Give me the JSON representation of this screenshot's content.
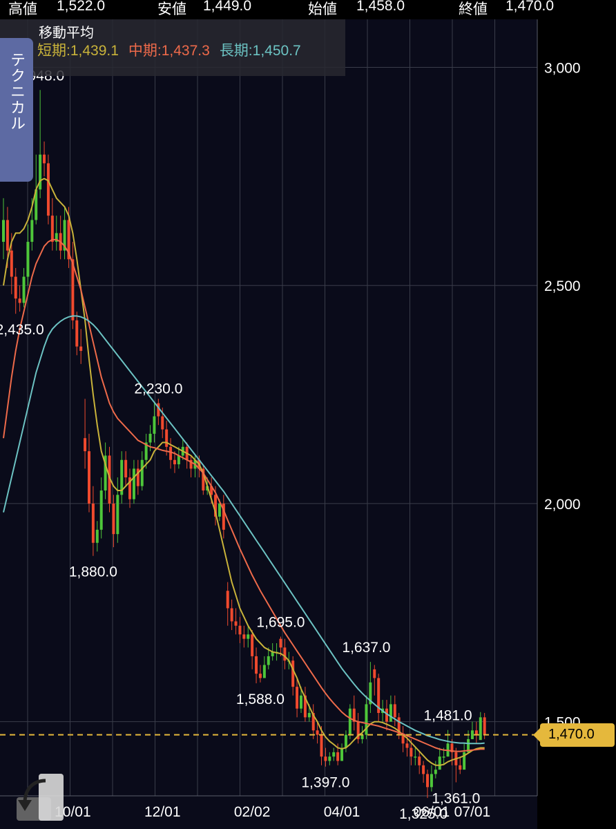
{
  "ohlc": {
    "high_label": "高値",
    "high_value": "1,522.0",
    "low_label": "安値",
    "low_value": "1,449.0",
    "open_label": "始値",
    "open_value": "1,458.0",
    "close_label": "終値",
    "close_value": "1,470.0"
  },
  "moving_average": {
    "title": "移動平均",
    "short": "短期:1,439.1",
    "mid": "中期:1,437.3",
    "long": "長期:1,450.7"
  },
  "technical_tab": "テクニカル",
  "current_price_tag": "1,470.0",
  "colors": {
    "background": "#0a0b1a",
    "grid": "#3a3d4a",
    "up": "#4ec63a",
    "down": "#f04a2e",
    "ma_short": "#c9b33a",
    "ma_mid": "#ee6a4a",
    "ma_long": "#6cc3c3",
    "price_line": "#e5b83c"
  },
  "chart_data": {
    "type": "candlestick",
    "y_ticks": [
      "3,000",
      "2,500",
      "2,000",
      "1,500"
    ],
    "y_tick_values": [
      3000,
      2500,
      2000,
      1500
    ],
    "ylim": [
      1330,
      3110
    ],
    "x_ticks": [
      "10/01",
      "12/01",
      "02/02",
      "04/01",
      "06/01",
      "07/01"
    ],
    "x_tick_index": [
      17,
      39,
      61,
      83,
      105,
      115
    ],
    "x_range": [
      0,
      125
    ],
    "annotations": [
      {
        "label": "2,948.0",
        "index": 9,
        "value": 2948
      },
      {
        "label": "2,435.0",
        "index": 4,
        "value": 2435
      },
      {
        "label": "2,230.0",
        "index": 38,
        "value": 2230
      },
      {
        "label": "1,880.0",
        "index": 22,
        "value": 1880
      },
      {
        "label": "1,695.0",
        "index": 68,
        "value": 1695
      },
      {
        "label": "1,588.0",
        "index": 63,
        "value": 1588
      },
      {
        "label": "1,637.0",
        "index": 89,
        "value": 1637
      },
      {
        "label": "1,397.0",
        "index": 79,
        "value": 1397
      },
      {
        "label": "1,481.0",
        "index": 109,
        "value": 1481
      },
      {
        "label": "1,361.0",
        "index": 111,
        "value": 1361
      },
      {
        "label": "1,325.0",
        "index": 103,
        "value": 1325
      }
    ],
    "close": [
      2650,
      2580,
      2520,
      2470,
      2460,
      2520,
      2600,
      2650,
      2720,
      2800,
      2780,
      2660,
      2600,
      2620,
      2580,
      2650,
      2560,
      2420,
      2360,
      2350,
      2120,
      2000,
      1910,
      1940,
      2030,
      2110,
      2000,
      1930,
      2020,
      2100,
      2060,
      2010,
      2080,
      2040,
      2100,
      2140,
      2160,
      2200,
      2200,
      2170,
      2130,
      2100,
      2090,
      2110,
      2130,
      2100,
      2080,
      2100,
      2080,
      2030,
      2040,
      2020,
      1970,
      2000,
      1940,
      1760,
      1730,
      1720,
      1700,
      1690,
      1700,
      1650,
      1610,
      1600,
      1630,
      1650,
      1660,
      1660,
      1670,
      1640,
      1640,
      1580,
      1530,
      1560,
      1510,
      1520,
      1480,
      1470,
      1420,
      1410,
      1420,
      1430,
      1410,
      1440,
      1470,
      1530,
      1500,
      1460,
      1470,
      1540,
      1590,
      1600,
      1520,
      1530,
      1500,
      1540,
      1510,
      1470,
      1450,
      1440,
      1420,
      1420,
      1400,
      1380,
      1350,
      1380,
      1390,
      1420,
      1420,
      1450,
      1430,
      1400,
      1390,
      1430,
      1460,
      1480,
      1470,
      1510,
      1470
    ],
    "open": [
      2600,
      2650,
      2580,
      2520,
      2470,
      2460,
      2520,
      2600,
      2650,
      2720,
      2800,
      2780,
      2660,
      2600,
      2620,
      2580,
      2650,
      2560,
      2420,
      2360,
      2150,
      2120,
      2000,
      1910,
      1940,
      2030,
      2110,
      2000,
      1930,
      2020,
      2100,
      2060,
      2010,
      2080,
      2040,
      2100,
      2140,
      2160,
      2230,
      2200,
      2170,
      2130,
      2100,
      2090,
      2110,
      2130,
      2100,
      2080,
      2100,
      2080,
      2030,
      2040,
      2020,
      1970,
      2000,
      1800,
      1760,
      1730,
      1720,
      1700,
      1690,
      1700,
      1650,
      1610,
      1600,
      1630,
      1650,
      1660,
      1690,
      1670,
      1640,
      1640,
      1580,
      1530,
      1560,
      1510,
      1520,
      1480,
      1470,
      1420,
      1410,
      1420,
      1430,
      1410,
      1440,
      1470,
      1530,
      1500,
      1460,
      1470,
      1540,
      1620,
      1600,
      1520,
      1530,
      1500,
      1540,
      1510,
      1470,
      1450,
      1440,
      1420,
      1420,
      1400,
      1380,
      1350,
      1380,
      1390,
      1420,
      1420,
      1450,
      1430,
      1400,
      1390,
      1430,
      1460,
      1480,
      1458,
      1510
    ],
    "high": [
      2700,
      2680,
      2620,
      2540,
      2500,
      2540,
      2640,
      2700,
      2800,
      2948,
      2830,
      2800,
      2700,
      2660,
      2660,
      2680,
      2680,
      2600,
      2440,
      2400,
      2240,
      2160,
      2040,
      1960,
      2060,
      2140,
      2130,
      2020,
      2060,
      2120,
      2120,
      2080,
      2100,
      2100,
      2120,
      2160,
      2180,
      2230,
      2240,
      2220,
      2190,
      2150,
      2120,
      2130,
      2150,
      2140,
      2110,
      2110,
      2110,
      2090,
      2060,
      2060,
      2040,
      2010,
      2020,
      1820,
      1780,
      1760,
      1740,
      1720,
      1720,
      1710,
      1670,
      1630,
      1650,
      1670,
      1680,
      1680,
      1695,
      1690,
      1660,
      1650,
      1600,
      1580,
      1580,
      1540,
      1540,
      1500,
      1490,
      1440,
      1430,
      1440,
      1450,
      1450,
      1480,
      1540,
      1560,
      1520,
      1490,
      1560,
      1637,
      1630,
      1610,
      1550,
      1550,
      1560,
      1560,
      1520,
      1490,
      1470,
      1460,
      1440,
      1430,
      1410,
      1390,
      1400,
      1410,
      1440,
      1440,
      1481,
      1460,
      1440,
      1420,
      1450,
      1480,
      1500,
      1500,
      1522,
      1520
    ],
    "low": [
      2560,
      2540,
      2480,
      2435,
      2440,
      2450,
      2500,
      2580,
      2640,
      2700,
      2750,
      2640,
      2580,
      2580,
      2560,
      2560,
      2540,
      2400,
      2340,
      2320,
      2080,
      1980,
      1880,
      1890,
      1920,
      2010,
      1980,
      1900,
      1910,
      2000,
      2040,
      1990,
      2000,
      2020,
      2030,
      2080,
      2120,
      2140,
      2180,
      2150,
      2110,
      2080,
      2070,
      2080,
      2100,
      2080,
      2060,
      2060,
      2060,
      2020,
      2020,
      2000,
      1950,
      1960,
      1920,
      1720,
      1710,
      1700,
      1680,
      1670,
      1670,
      1620,
      1588,
      1590,
      1600,
      1620,
      1640,
      1640,
      1650,
      1620,
      1620,
      1560,
      1510,
      1520,
      1500,
      1500,
      1460,
      1450,
      1400,
      1397,
      1400,
      1410,
      1400,
      1410,
      1430,
      1460,
      1480,
      1450,
      1450,
      1460,
      1520,
      1560,
      1500,
      1500,
      1480,
      1500,
      1490,
      1460,
      1430,
      1420,
      1400,
      1400,
      1380,
      1360,
      1325,
      1340,
      1370,
      1400,
      1400,
      1420,
      1400,
      1361,
      1380,
      1410,
      1440,
      1460,
      1449,
      1470,
      1460
    ],
    "series": [
      {
        "name": "短期",
        "values": [
          2500,
          2560,
          2600,
          2620,
          2620,
          2630,
          2650,
          2680,
          2720,
          2740,
          2745,
          2740,
          2720,
          2700,
          2690,
          2680,
          2660,
          2620,
          2560,
          2490,
          2420,
          2330,
          2250,
          2180,
          2120,
          2090,
          2060,
          2040,
          2030,
          2030,
          2040,
          2050,
          2060,
          2070,
          2080,
          2090,
          2100,
          2120,
          2130,
          2140,
          2140,
          2135,
          2130,
          2125,
          2120,
          2115,
          2110,
          2100,
          2090,
          2070,
          2040,
          2010,
          1980,
          1940,
          1900,
          1860,
          1820,
          1790,
          1760,
          1740,
          1720,
          1705,
          1690,
          1680,
          1670,
          1665,
          1660,
          1658,
          1656,
          1650,
          1640,
          1620,
          1600,
          1575,
          1555,
          1535,
          1515,
          1500,
          1480,
          1465,
          1455,
          1448,
          1440,
          1438,
          1440,
          1448,
          1458,
          1468,
          1475,
          1485,
          1495,
          1500,
          1500,
          1498,
          1494,
          1490,
          1485,
          1478,
          1470,
          1462,
          1452,
          1442,
          1432,
          1422,
          1412,
          1405,
          1400,
          1400,
          1402,
          1408,
          1412,
          1415,
          1418,
          1422,
          1428,
          1434,
          1438,
          1440,
          1440
        ]
      },
      {
        "name": "中期",
        "values": [
          2150,
          2220,
          2290,
          2350,
          2400,
          2440,
          2480,
          2520,
          2550,
          2570,
          2590,
          2600,
          2605,
          2605,
          2600,
          2590,
          2575,
          2550,
          2520,
          2490,
          2450,
          2410,
          2370,
          2330,
          2290,
          2260,
          2230,
          2210,
          2195,
          2185,
          2175,
          2165,
          2155,
          2145,
          2140,
          2135,
          2130,
          2128,
          2125,
          2122,
          2120,
          2118,
          2115,
          2110,
          2105,
          2100,
          2095,
          2090,
          2080,
          2070,
          2055,
          2040,
          2025,
          2005,
          1985,
          1962,
          1940,
          1918,
          1896,
          1876,
          1856,
          1836,
          1818,
          1800,
          1784,
          1768,
          1752,
          1736,
          1720,
          1704,
          1690,
          1676,
          1662,
          1648,
          1634,
          1620,
          1606,
          1592,
          1578,
          1565,
          1553,
          1542,
          1532,
          1522,
          1514,
          1508,
          1503,
          1500,
          1498,
          1496,
          1494,
          1492,
          1490,
          1487,
          1484,
          1481,
          1478,
          1475,
          1472,
          1468,
          1464,
          1460,
          1456,
          1452,
          1448,
          1444,
          1440,
          1437,
          1435,
          1434,
          1433,
          1432,
          1432,
          1433,
          1434,
          1435,
          1436,
          1437,
          1437
        ]
      },
      {
        "name": "長期",
        "values": [
          1980,
          2020,
          2060,
          2100,
          2140,
          2180,
          2220,
          2260,
          2300,
          2330,
          2360,
          2385,
          2400,
          2410,
          2418,
          2424,
          2428,
          2430,
          2430,
          2428,
          2424,
          2418,
          2410,
          2400,
          2388,
          2376,
          2364,
          2352,
          2340,
          2328,
          2316,
          2304,
          2292,
          2280,
          2268,
          2256,
          2244,
          2232,
          2220,
          2208,
          2196,
          2184,
          2172,
          2160,
          2148,
          2136,
          2124,
          2112,
          2100,
          2088,
          2076,
          2064,
          2052,
          2040,
          2028,
          2014,
          2000,
          1986,
          1972,
          1958,
          1944,
          1930,
          1916,
          1902,
          1888,
          1874,
          1860,
          1846,
          1832,
          1818,
          1804,
          1790,
          1776,
          1762,
          1748,
          1734,
          1720,
          1706,
          1692,
          1678,
          1664,
          1650,
          1636,
          1622,
          1610,
          1598,
          1586,
          1575,
          1565,
          1556,
          1548,
          1540,
          1532,
          1525,
          1518,
          1512,
          1506,
          1500,
          1495,
          1490,
          1485,
          1480,
          1476,
          1472,
          1468,
          1465,
          1462,
          1459,
          1457,
          1455,
          1453,
          1452,
          1451,
          1451,
          1450,
          1450,
          1450,
          1450,
          1451
        ]
      }
    ]
  }
}
